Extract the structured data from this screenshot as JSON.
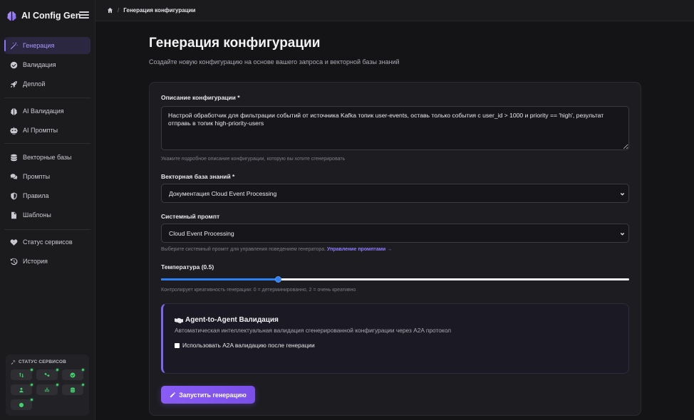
{
  "app": {
    "title": "AI Config Gen"
  },
  "sidebar": {
    "groups": [
      [
        {
          "label": "Генерация",
          "icon": "magic-wand-icon",
          "active": true
        },
        {
          "label": "Валидация",
          "icon": "check-circle-icon"
        },
        {
          "label": "Деплой",
          "icon": "rocket-icon"
        }
      ],
      [
        {
          "label": "AI Валидация",
          "icon": "brain-icon"
        },
        {
          "label": "AI Промпты",
          "icon": "robot-icon"
        }
      ],
      [
        {
          "label": "Векторные базы",
          "icon": "database-icon"
        },
        {
          "label": "Промпты",
          "icon": "comments-icon"
        },
        {
          "label": "Правила",
          "icon": "shield-icon"
        },
        {
          "label": "Шаблоны",
          "icon": "file-icon"
        }
      ],
      [
        {
          "label": "Статус сервисов",
          "icon": "heartbeat-icon"
        },
        {
          "label": "История",
          "icon": "history-icon"
        }
      ]
    ]
  },
  "service_status": {
    "title": "СТАТУС СЕРВИСОВ",
    "items": [
      {
        "icon": "transfer-icon",
        "status": "online"
      },
      {
        "icon": "nodes-icon",
        "status": "online"
      },
      {
        "icon": "check-icon",
        "status": "online"
      },
      {
        "icon": "user-upload-icon",
        "status": "online"
      },
      {
        "icon": "network-icon",
        "status": "online"
      },
      {
        "icon": "database-icon",
        "status": "online"
      },
      {
        "icon": "circle-icon",
        "status": "online"
      }
    ]
  },
  "breadcrumb": {
    "current": "Генерация конфигурации"
  },
  "page": {
    "title": "Генерация конфигурации",
    "subtitle": "Создайте новую конфигурацию на основе вашего запроса и векторной базы знаний"
  },
  "form": {
    "description": {
      "label": "Описание конфигурации *",
      "value": "Настрой обработчик для фильтрации событий от источника Kafka топик user-events, оставь только события с user_id > 1000 и priority == 'high', результат отправь в топик high-priority-users",
      "help": "Укажите подробное описание конфигурации, которую вы хотите сгенерировать"
    },
    "vector_db": {
      "label": "Векторная база знаний *",
      "value": "Документация Cloud Event Processing"
    },
    "system_prompt": {
      "label": "Системный промпт",
      "value": "Cloud Event Processing",
      "help": "Выберите системный промпт для управления поведением генератора.",
      "help_link": "Управление промптами →"
    },
    "temperature": {
      "label": "Температура (0.5)",
      "value": 0.5,
      "min": 0,
      "max": 2,
      "help": "Контролирует креативность генерации: 0 = детерминированно, 2 = очень креативно"
    },
    "a2a": {
      "title": "Agent-to-Agent Валидация",
      "description": "Автоматическая интеллектуальная валидация сгенерированной конфигурации через A2A протокол",
      "checkbox_label": "Использовать A2A валидацию после генерации",
      "checked": false
    },
    "submit_label": "Запустить генерацию"
  },
  "colors": {
    "accent": "#8d74ff",
    "slider": "#2f7ff0",
    "status_ok": "#3ed46c"
  }
}
